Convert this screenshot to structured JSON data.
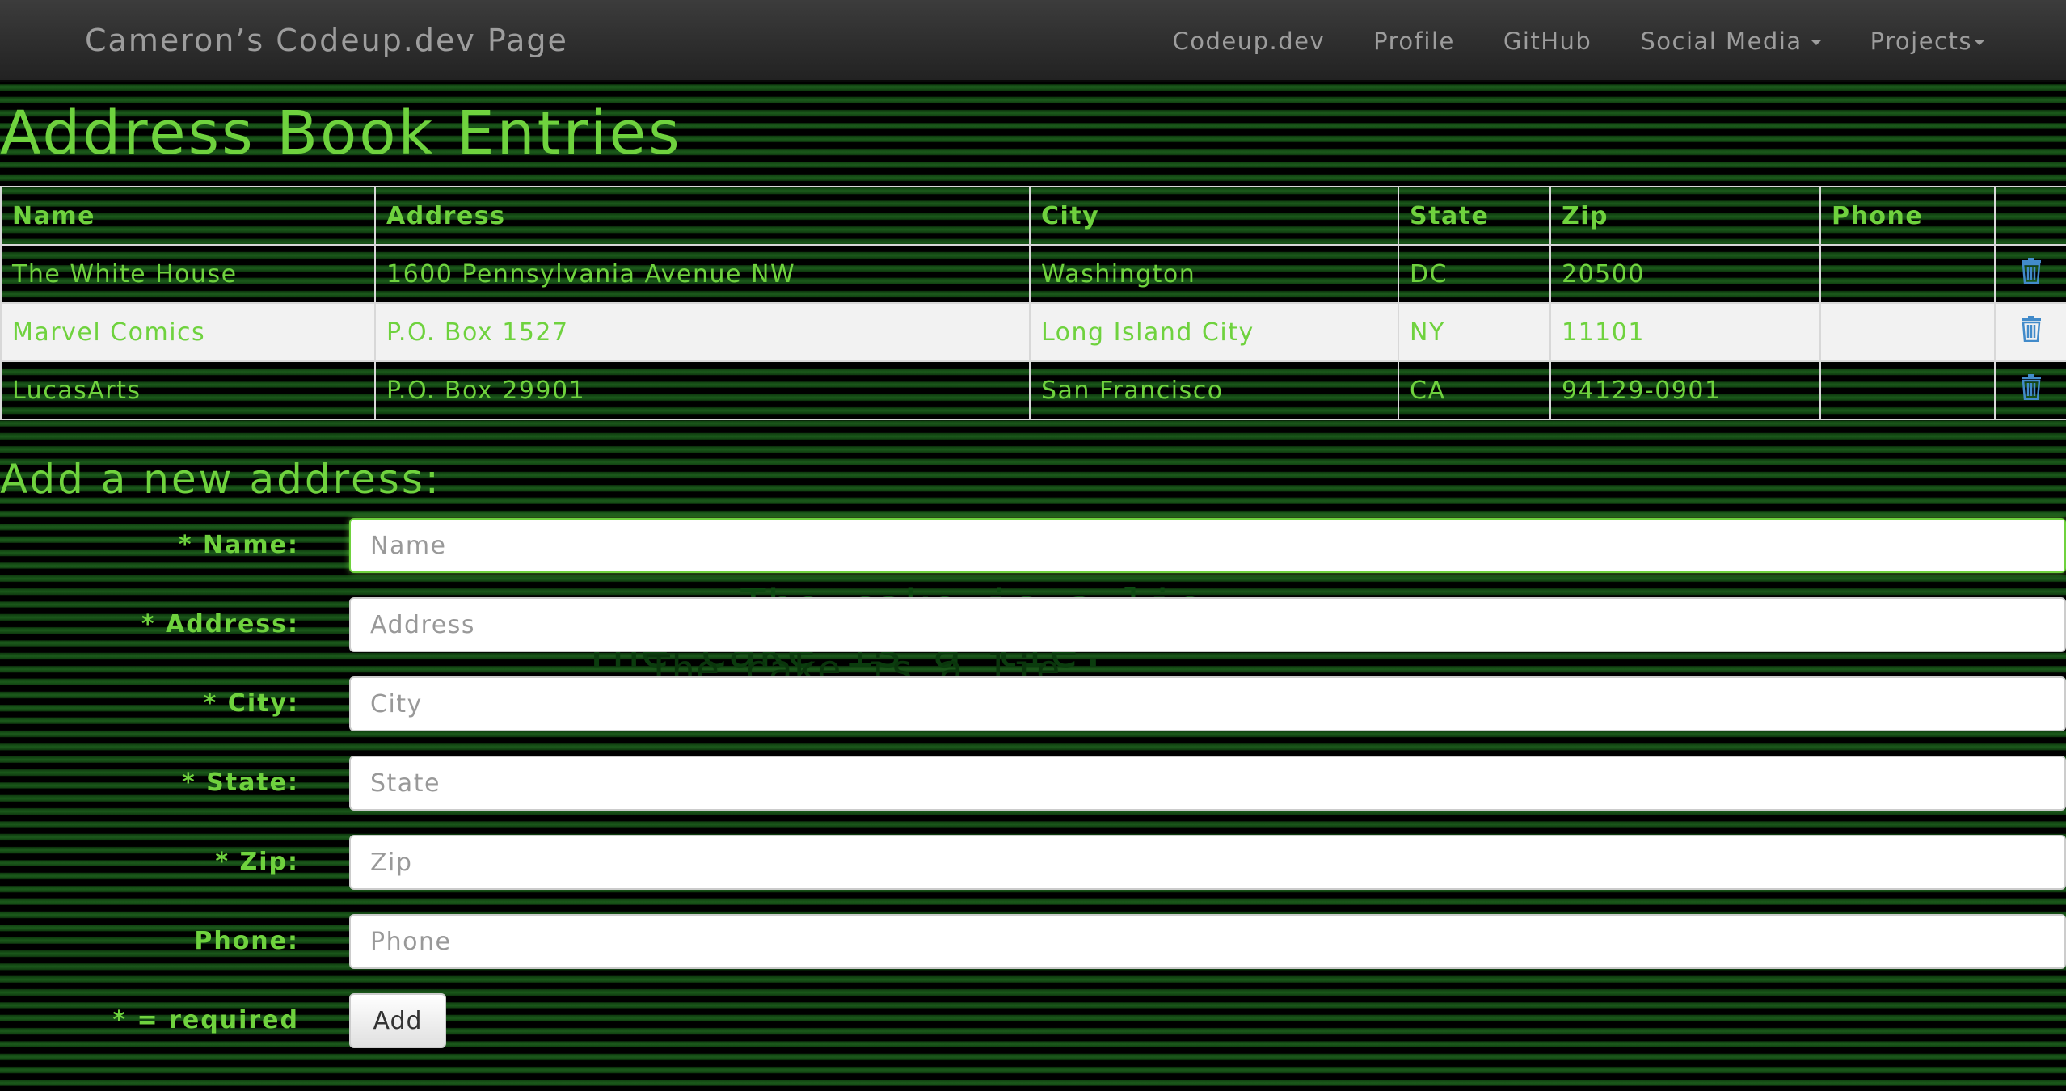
{
  "navbar": {
    "brand": "Cameron’s Codeup.dev Page",
    "links": [
      {
        "label": "Codeup.dev"
      },
      {
        "label": "Profile"
      },
      {
        "label": "GitHub"
      },
      {
        "label": "Social Media"
      },
      {
        "label": "Projects"
      }
    ]
  },
  "page_title": "Address Book Entries",
  "table": {
    "headers": [
      "Name",
      "Address",
      "City",
      "State",
      "Zip",
      "Phone",
      ""
    ],
    "rows": [
      {
        "name": "The White House",
        "address": "1600 Pennsylvania Avenue NW",
        "city": "Washington",
        "state": "DC",
        "zip": "20500",
        "phone": ""
      },
      {
        "name": "Marvel Comics",
        "address": "P.O. Box 1527",
        "city": "Long Island City",
        "state": "NY",
        "zip": "11101",
        "phone": ""
      },
      {
        "name": "LucasArts",
        "address": "P.O. Box 29901",
        "city": "San Francisco",
        "state": "CA",
        "zip": "94129-0901",
        "phone": ""
      }
    ],
    "delete_icon": "trash-icon"
  },
  "form": {
    "title": "Add a new address:",
    "fields": [
      {
        "label": "* Name:",
        "placeholder": "Name",
        "value": ""
      },
      {
        "label": "* Address:",
        "placeholder": "Address",
        "value": ""
      },
      {
        "label": "* City:",
        "placeholder": "City",
        "value": ""
      },
      {
        "label": "* State:",
        "placeholder": "State",
        "value": ""
      },
      {
        "label": "* Zip:",
        "placeholder": "Zip",
        "value": ""
      },
      {
        "label": "Phone:",
        "placeholder": "Phone",
        "value": ""
      }
    ],
    "required_note": "* = required",
    "submit_label": "Add"
  },
  "background": {
    "ghost_text": [
      "The cake is a lie.",
      "The cake is a lie.",
      "The cake is a lie."
    ]
  },
  "colors": {
    "accent_green": "#6fd23e",
    "navbar_text": "#9d9d9d",
    "trash_blue": "#428bca"
  }
}
